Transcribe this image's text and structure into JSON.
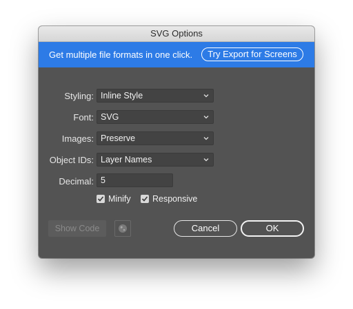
{
  "window": {
    "title": "SVG Options"
  },
  "promo": {
    "text": "Get multiple file formats in one click.",
    "button_label": "Try Export for Screens",
    "color": "#2d7be6"
  },
  "form": {
    "styling": {
      "label": "Styling:",
      "value": "Inline Style"
    },
    "font": {
      "label": "Font:",
      "value": "SVG"
    },
    "images": {
      "label": "Images:",
      "value": "Preserve"
    },
    "object_ids": {
      "label": "Object IDs:",
      "value": "Layer Names"
    },
    "decimal": {
      "label": "Decimal:",
      "value": "5"
    },
    "minify": {
      "label": "Minify",
      "checked": true
    },
    "responsive": {
      "label": "Responsive",
      "checked": true
    }
  },
  "footer": {
    "show_code_label": "Show Code",
    "globe_icon": "globe-icon",
    "cancel_label": "Cancel",
    "ok_label": "OK"
  }
}
